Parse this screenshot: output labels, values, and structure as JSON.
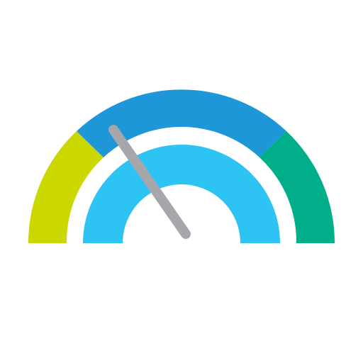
{
  "icon": {
    "name": "speedometer-gauge-icon",
    "colors": {
      "background": "#ffffff",
      "segment_low": "#cbd800",
      "segment_mid": "#1e97d8",
      "segment_high": "#00ae8a",
      "inner_arc": "#2dc3f2",
      "needle": "#a5a7ab"
    }
  }
}
